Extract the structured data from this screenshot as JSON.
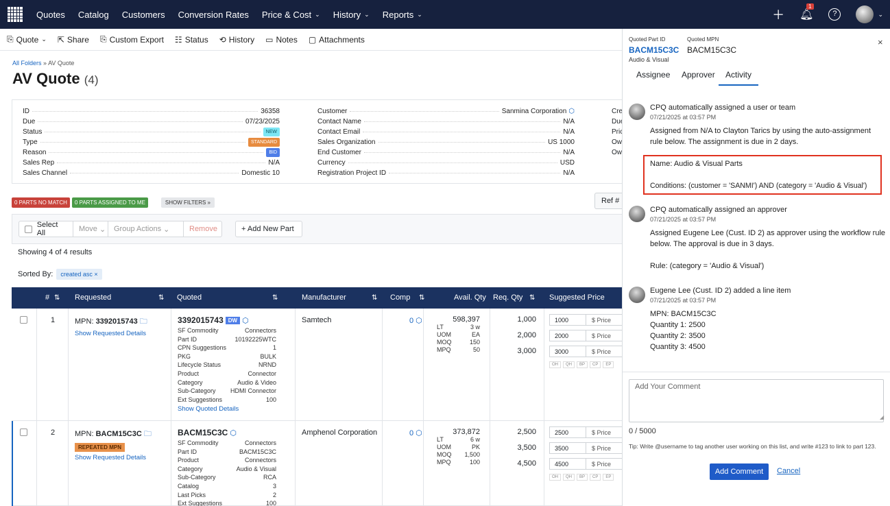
{
  "topnav": {
    "items": [
      "Quotes",
      "Catalog",
      "Customers",
      "Conversion Rates",
      "Price & Cost",
      "History",
      "Reports"
    ],
    "dropdowns": [
      false,
      false,
      false,
      false,
      true,
      true,
      true
    ],
    "notif_count": "1"
  },
  "toolbar": {
    "items": [
      "Quote",
      "Share",
      "Custom Export",
      "Status",
      "History",
      "Notes",
      "Attachments"
    ]
  },
  "breadcrumb": {
    "root": "All Folders",
    "sep": "»",
    "current": "AV Quote"
  },
  "title": {
    "name": "AV Quote",
    "count": "(4)"
  },
  "info": {
    "left": [
      {
        "k": "ID",
        "v": "36358"
      },
      {
        "k": "Due",
        "v": "07/23/2025"
      },
      {
        "k": "Status",
        "v": "NEW"
      },
      {
        "k": "Type",
        "v": "STANDARD"
      },
      {
        "k": "Reason",
        "v": "BID"
      },
      {
        "k": "Sales Rep",
        "v": "N/A"
      },
      {
        "k": "Sales Channel",
        "v": "Domestic 10"
      }
    ],
    "mid": [
      {
        "k": "Customer",
        "v": "Sanmina Corporation"
      },
      {
        "k": "Contact Name",
        "v": "N/A"
      },
      {
        "k": "Contact Email",
        "v": "N/A"
      },
      {
        "k": "Sales Organization",
        "v": "US 1000"
      },
      {
        "k": "End Customer",
        "v": "N/A"
      },
      {
        "k": "Currency",
        "v": "USD"
      },
      {
        "k": "Registration Project ID",
        "v": "N/A"
      }
    ],
    "right": [
      "Cre",
      "Due",
      "Pric",
      "Ow",
      "Ow"
    ]
  },
  "filters": {
    "no_match": "0 PARTS NO MATCH",
    "assigned": "0 PARTS ASSIGNED TO ME",
    "show": "SHOW FILTERS »",
    "ref": "Ref #"
  },
  "actions": {
    "select_all": "Select All",
    "move": "Move",
    "group": "Group Actions",
    "remove": "Remove",
    "add": "+ Add New Part"
  },
  "showing": "Showing 4 of 4 results",
  "sorted": {
    "label": "Sorted By:",
    "chip": "created asc ×"
  },
  "columns": [
    "#",
    "Requested",
    "Quoted",
    "Manufacturer",
    "Comp",
    "Avail. Qty",
    "Req. Qty",
    "Suggested Price"
  ],
  "rows": [
    {
      "num": "1",
      "req_prefix": "MPN: ",
      "req_mpn": "3392015743",
      "req_link": "Show Requested Details",
      "q_mpn": "3392015743",
      "q_badge": "DW",
      "q_kv": [
        [
          "SF Commodity",
          "Connectors"
        ],
        [
          "Part ID",
          "10192225WTC"
        ],
        [
          "CPN Suggestions",
          "1"
        ],
        [
          "PKG",
          "BULK"
        ],
        [
          "Lifecycle Status",
          "NRND"
        ],
        [
          "Product",
          "Connector"
        ],
        [
          "Category",
          "Audio & Video"
        ],
        [
          "Sub-Category",
          "HDMI Connector"
        ],
        [
          "Ext Suggestions",
          "100"
        ]
      ],
      "q_link": "Show Quoted Details",
      "mfr": "Samtech",
      "comp": "0",
      "avail": "598,397",
      "avail_kv": [
        [
          "LT",
          "3 w"
        ],
        [
          "UOM",
          "EA"
        ],
        [
          "MOQ",
          "150"
        ],
        [
          "MPQ",
          "50"
        ]
      ],
      "req_qty": [
        "1,000",
        "2,000",
        "3,000"
      ],
      "price_qty": [
        "1000",
        "2000",
        "3000"
      ],
      "price_ph": "$ Price"
    },
    {
      "num": "2",
      "req_prefix": "MPN: ",
      "req_mpn": "BACM15C3C",
      "req_badge": "REPEATED MPN",
      "req_link": "Show Requested Details",
      "q_mpn": "BACM15C3C",
      "q_kv": [
        [
          "SF Commodity",
          "Connectors"
        ],
        [
          "Part ID",
          "BACM15C3C"
        ],
        [
          "Product",
          "Connectors"
        ],
        [
          "Category",
          "Audio & Visual"
        ],
        [
          "Sub-Category",
          "RCA"
        ],
        [
          "Catalog",
          "3"
        ],
        [
          "Last Picks",
          "2"
        ],
        [
          "Ext Suggestions",
          "100"
        ]
      ],
      "mfr": "Amphenol Corporation",
      "comp": "0",
      "avail": "373,872",
      "avail_kv": [
        [
          "LT",
          "6 w"
        ],
        [
          "UOM",
          "PK"
        ],
        [
          "MOQ",
          "1,500"
        ],
        [
          "MPQ",
          "100"
        ]
      ],
      "req_qty": [
        "2,500",
        "3,500",
        "4,500"
      ],
      "price_qty": [
        "2500",
        "3500",
        "4500"
      ],
      "price_ph": "$ Price"
    }
  ],
  "mini_btns": [
    "OH",
    "QH",
    "BP",
    "CP",
    "EP"
  ],
  "panel": {
    "pid_label": "Quoted Part ID",
    "mpn_label": "Quoted MPN",
    "pid": "BACM15C3C",
    "mpn": "BACM15C3C",
    "category": "Audio & Visual",
    "tabs": [
      "Assignee",
      "Approver",
      "Activity"
    ],
    "activities": [
      {
        "title": "CPQ automatically assigned a user or team",
        "time": "07/21/2025 at 03:57 PM",
        "lines": [
          "Assigned from N/A to Clayton Tarics by using the auto-assignment",
          "rule below. The assignment is due in 2 days.",
          "",
          "Name: Audio & Visual Parts",
          "",
          "Conditions: (customer = 'SANMI') AND (category = 'Audio & Visual')"
        ]
      },
      {
        "title": "CPQ automatically assigned an approver",
        "time": "07/21/2025 at 03:57 PM",
        "lines": [
          "Assigned Eugene Lee (Cust. ID 2) as approver using the workflow rule",
          "below. The approval is due in 3 days.",
          "",
          "Rule: (category = 'Audio & Visual')"
        ]
      },
      {
        "title": "Eugene Lee (Cust. ID 2) added a line item",
        "time": "07/21/2025 at 03:57 PM",
        "lines": [
          "MPN: BACM15C3C",
          "Quantity 1: 2500",
          "Quantity 2: 3500",
          "Quantity 3: 4500"
        ]
      }
    ],
    "comment_ph": "Add Your Comment",
    "counter": "0 / 5000",
    "tip": "Tip: Write @username to tag another user working on this list, and write #123 to link to part 123.",
    "add": "Add Comment",
    "cancel": "Cancel"
  }
}
